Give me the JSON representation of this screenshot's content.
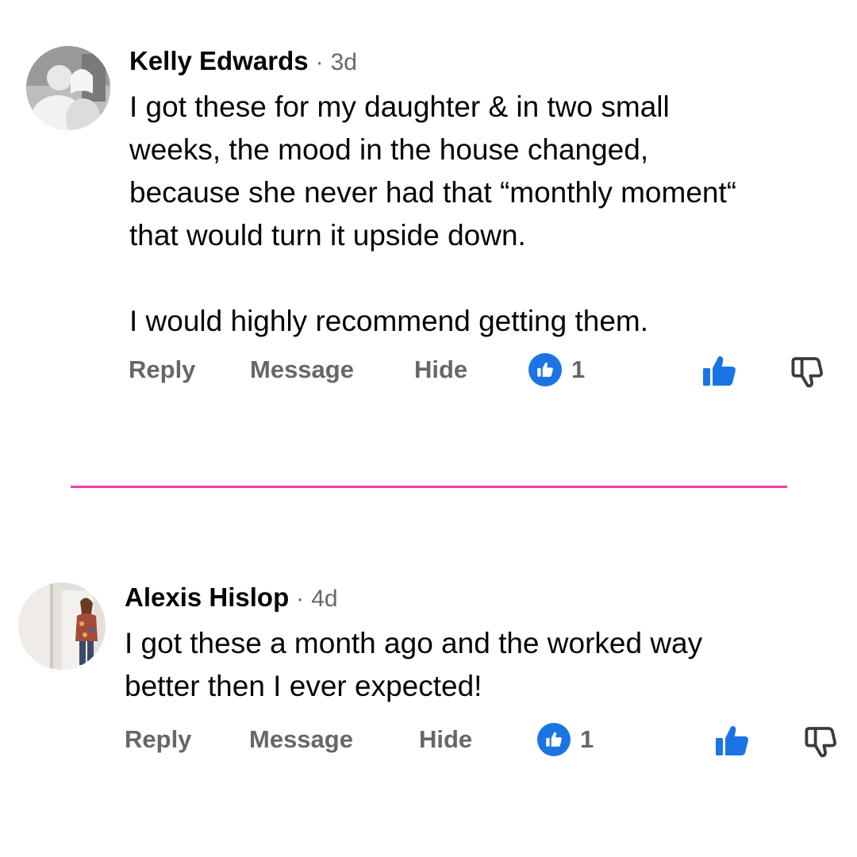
{
  "comments": [
    {
      "author": "Kelly Edwards",
      "separator": "·",
      "time": "3d",
      "lines": [
        "I got these for my daughter & in two small",
        "weeks, the mood in the house changed,",
        "because she never had that “monthly moment“",
        "that would turn it upside down.",
        "",
        "I would highly recommend getting them."
      ],
      "actions": {
        "reply": "Reply",
        "message": "Message",
        "hide": "Hide"
      },
      "reaction_count": "1",
      "reaction_icon": "like-badge-icon",
      "like_icon": "thumbs-up-icon",
      "dislike_icon": "thumbs-down-icon"
    },
    {
      "author": "Alexis Hislop",
      "separator": "·",
      "time": "4d",
      "lines": [
        "I got these a month ago and the worked way",
        "better then I ever expected!"
      ],
      "actions": {
        "reply": "Reply",
        "message": "Message",
        "hide": "Hide"
      },
      "reaction_count": "1",
      "reaction_icon": "like-badge-icon",
      "like_icon": "thumbs-up-icon",
      "dislike_icon": "thumbs-down-icon"
    }
  ],
  "colors": {
    "text_primary": "#050505",
    "text_secondary": "#65676b",
    "like_blue": "#1b74e4",
    "divider": "#ee3fad"
  }
}
